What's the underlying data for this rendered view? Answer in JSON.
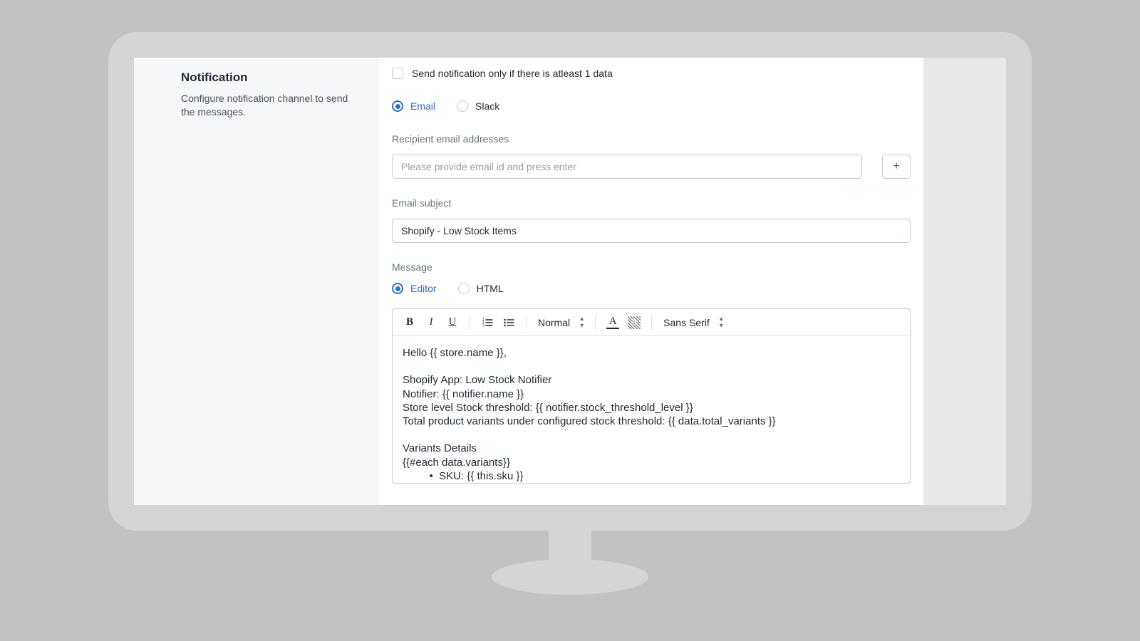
{
  "sidebar": {
    "title": "Notification",
    "description": "Configure notification channel to send the messages."
  },
  "check": {
    "label": "Send notification only if there is atleast 1 data"
  },
  "channel": {
    "email": "Email",
    "slack": "Slack"
  },
  "recipient": {
    "label": "Recipient email addresses",
    "placeholder": "Please provide email id and press enter",
    "add": "+"
  },
  "subject": {
    "label": "Email subject",
    "value": "Shopify - Low Stock Items"
  },
  "message": {
    "label": "Message",
    "editor": "Editor",
    "html": "HTML"
  },
  "toolbar": {
    "heading": "Normal",
    "font": "Sans Serif"
  },
  "body": "Hello {{ store.name }},\n\nShopify App: Low Stock Notifier\nNotifier: {{ notifier.name }}\nStore level Stock threshold: {{ notifier.stock_threshold_level }}\nTotal product variants under configured stock threshold: {{ data.total_variants }}\n\nVariants Details\n{{#each data.variants}}\n         •  SKU: {{ this.sku }}"
}
